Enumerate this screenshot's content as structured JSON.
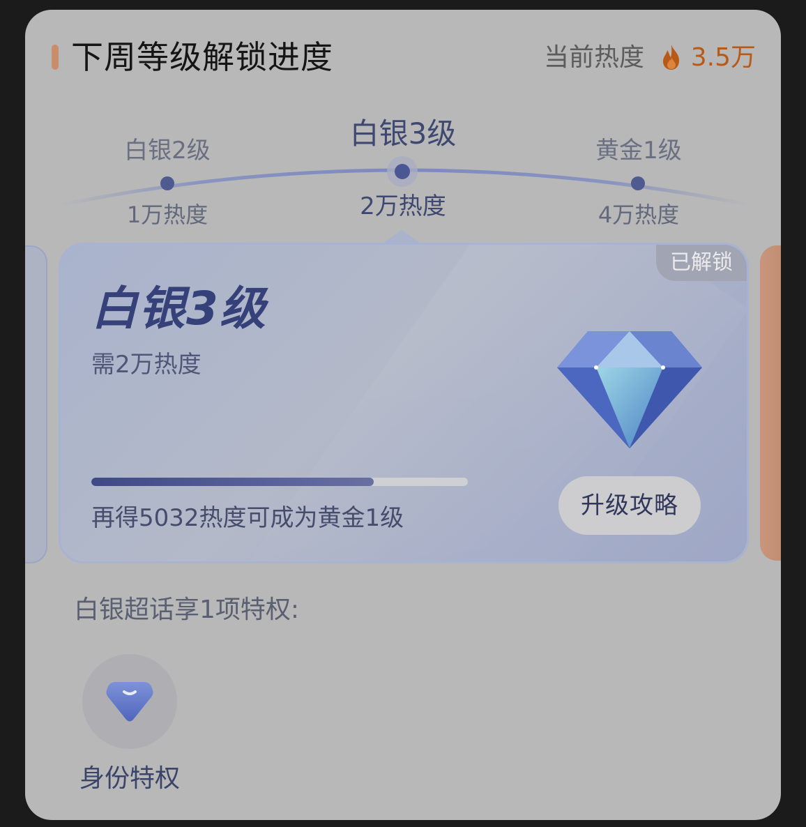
{
  "header": {
    "title": "下周等级解锁进度",
    "heat_label": "当前热度",
    "heat_value": "3.5万",
    "heat_icon": "fire-icon"
  },
  "levels": [
    {
      "name": "白银2级",
      "requirement": "1万热度",
      "active": false
    },
    {
      "name": "白银3级",
      "requirement": "2万热度",
      "active": true
    },
    {
      "name": "黄金1级",
      "requirement": "4万热度",
      "active": false
    }
  ],
  "card": {
    "status_tag": "已解锁",
    "title": "白银3级",
    "subtitle": "需2万热度",
    "progress_text": "再得5032热度可成为黄金1级",
    "progress_fraction": 0.75,
    "guide_button": "升级攻略",
    "icon": "diamond-icon"
  },
  "perks": {
    "heading": "白银超话享1项特权:",
    "items": [
      {
        "label": "身份特权",
        "icon": "identity-gem-icon"
      }
    ]
  },
  "colors": {
    "accent_orange": "#b85a16",
    "level_blue": "#3f4870"
  }
}
